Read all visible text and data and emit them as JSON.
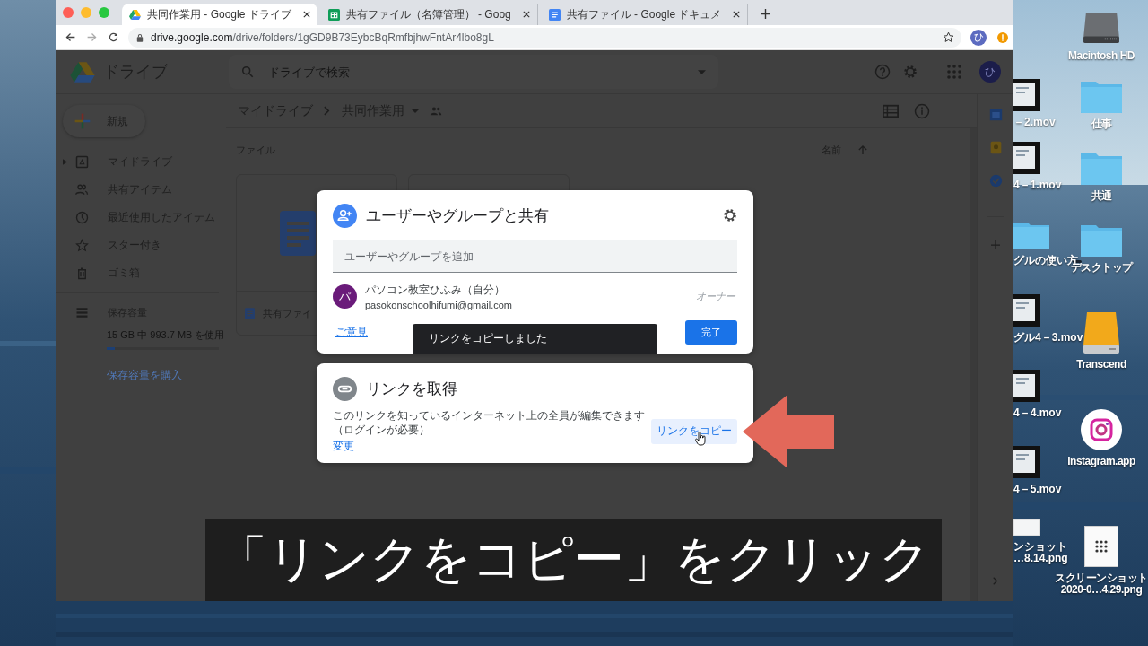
{
  "browser": {
    "tabs": [
      {
        "title": "共同作業用 - Google ドライブ",
        "selected": true,
        "kind": "drive"
      },
      {
        "title": "共有ファイル（名簿管理） - Goog",
        "selected": false,
        "kind": "sheets"
      },
      {
        "title": "共有ファイル - Google ドキュメ",
        "selected": false,
        "kind": "docs"
      }
    ],
    "url": {
      "host": "drive.google.com",
      "path": "/drive/folders/1gGD9B73EybcBqRmfbjhwFntAr4lbo8gL"
    },
    "profile_initial": "ひ"
  },
  "drive": {
    "app_name": "ドライブ",
    "search": {
      "placeholder": "ドライブで検索"
    },
    "account_initial": "ひ",
    "new_button": "新規",
    "nav": [
      {
        "label": "マイドライブ",
        "selected": false,
        "expanded": false
      },
      {
        "label": "共有アイテム",
        "selected": false
      },
      {
        "label": "最近使用したアイテム",
        "selected": false
      },
      {
        "label": "スター付き",
        "selected": false
      },
      {
        "label": "ゴミ箱",
        "selected": false
      }
    ],
    "storage": {
      "label": "保存容量",
      "usage": "15 GB 中 993.7 MB を使用",
      "level": 0.07,
      "buy_link": "保存容量を購入"
    },
    "breadcrumb": [
      "マイドライブ",
      "共同作業用"
    ],
    "section_title": "ファイル",
    "sort_label": "名前",
    "files": [
      {
        "name": "共有ファイ"
      }
    ]
  },
  "share_dialog": {
    "title": "ユーザーやグループと共有",
    "add_field": {
      "placeholder": "ユーザーやグループを追加"
    },
    "people": [
      {
        "initial": "パ",
        "name": "パソコン教室ひふみ（自分）",
        "email": "pasokonschoolhifumi@gmail.com",
        "role": "オーナー"
      }
    ],
    "feedback_link": "ご意見",
    "done_button": "完了"
  },
  "toast": "リンクをコピーしました",
  "link_dialog": {
    "title": "リンクを取得",
    "description": "このリンクを知っているインターネット上の全員が編集できます（ログインが必要）",
    "change_link": "変更",
    "copy_button": "リンクをコピー"
  },
  "caption": "「リンクをコピー」をクリック",
  "desktop": {
    "cut_column": [
      {
        "kind": "video",
        "lines": [
          "－2.mov"
        ]
      },
      {
        "kind": "video",
        "lines": [
          "4－1.mov"
        ]
      },
      {
        "kind": "folder",
        "lines": [
          "グルの使い方"
        ]
      },
      {
        "kind": "video",
        "lines": [
          "グル4－3.mov"
        ]
      },
      {
        "kind": "video",
        "lines": [
          "4－4.mov"
        ]
      },
      {
        "kind": "video",
        "lines": [
          "4－5.mov"
        ]
      },
      {
        "lines": [
          "ンショット",
          "…8.14.png"
        ]
      }
    ],
    "column": [
      {
        "kind": "drive",
        "lines": [
          "Macintosh HD"
        ]
      },
      {
        "kind": "folder",
        "lines": [
          "仕事"
        ]
      },
      {
        "kind": "folder",
        "lines": [
          "共通"
        ]
      },
      {
        "kind": "folder",
        "lines": [
          "デスクトップ"
        ]
      },
      {
        "kind": "external_drive",
        "lines": [
          "Transcend"
        ]
      },
      {
        "kind": "app",
        "lines": [
          "Instagram.app"
        ]
      },
      {
        "lines": [
          "スクリーンショット",
          "2020-0…4.29.png"
        ]
      }
    ]
  }
}
